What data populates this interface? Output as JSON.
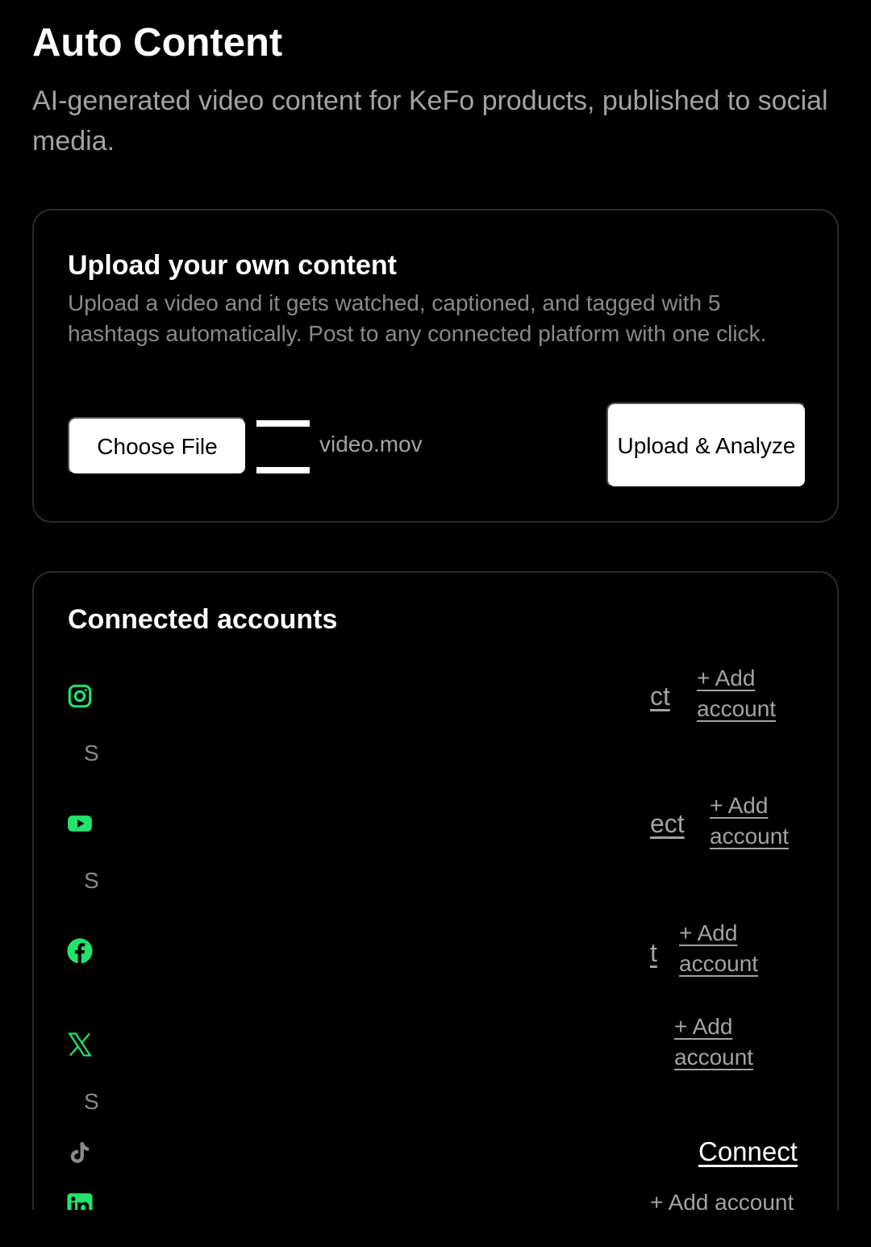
{
  "header": {
    "title": "Auto Content",
    "subtitle": "AI-generated video content for KeFo products, published to social media."
  },
  "upload": {
    "title": "Upload your own content",
    "description": "Upload a video and it gets watched, captioned, and tagged with 5 hashtags automatically. Post to any connected platform with one click.",
    "choose_file_label": "Choose File",
    "file_name": "video.mov",
    "submit_label": "Upload & Analyze"
  },
  "accounts": {
    "title": "Connected accounts",
    "platforms": [
      {
        "icon": "instagram-icon",
        "status_fragment": "S",
        "connect_fragment": "ct",
        "add_label": "+ Add account"
      },
      {
        "icon": "youtube-icon",
        "status_fragment": "S",
        "connect_fragment": "ect",
        "add_label": "+ Add account"
      },
      {
        "icon": "facebook-icon",
        "status_fragment": "",
        "connect_fragment": "t",
        "add_label": "+ Add account"
      },
      {
        "icon": "x-icon",
        "status_fragment": "S",
        "connect_fragment": "",
        "add_label": "+ Add account"
      },
      {
        "icon": "tiktok-icon",
        "status_fragment": "",
        "connect_fragment": "Connect",
        "add_label": ""
      },
      {
        "icon": "linkedin-icon",
        "status_fragment": "",
        "connect_fragment": "",
        "add_label": "+ Add account"
      }
    ]
  },
  "colors": {
    "background": "#000000",
    "accent_green": "#22e36b",
    "muted_text": "#a3a3a3",
    "card_border": "#2a2a2a",
    "tiktok_icon": "#8a8a8a"
  }
}
